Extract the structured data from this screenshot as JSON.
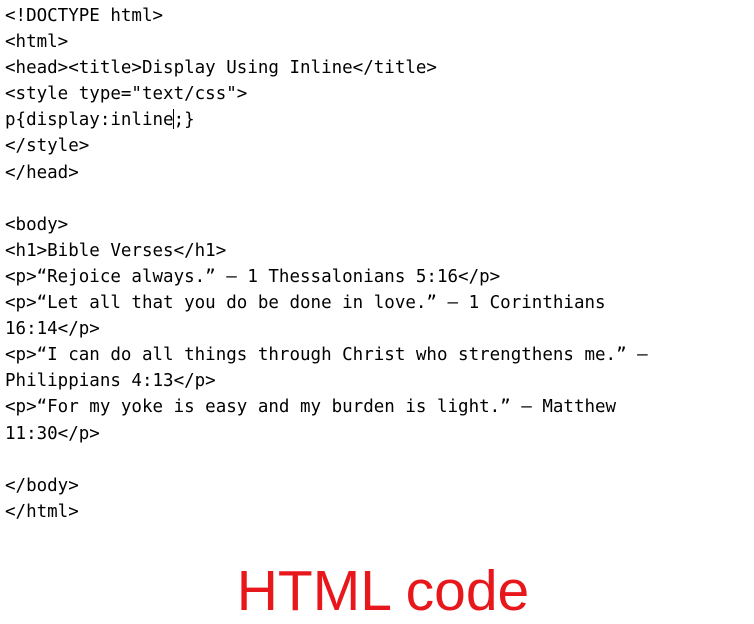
{
  "code": {
    "lines": [
      "<!DOCTYPE html>",
      "<html>",
      "<head><title>Display Using Inline</title>",
      "<style type=\"text/css\">",
      "p{display:inline;}",
      "</style>",
      "</head>",
      "",
      "<body>",
      "<h1>Bible Verses</h1>",
      "<p>“Rejoice always.” — 1 Thessalonians 5:16</p>",
      "<p>“Let all that you do be done in love.” — 1 Corinthians",
      "16:14</p>",
      "<p>“I can do all things through Christ who strengthens me.” —",
      "Philippians 4:13</p>",
      "<p>“For my yoke is easy and my burden is light.” — Matthew",
      "11:30</p>",
      "",
      "</body>",
      "</html>"
    ],
    "cursor_line_before": "p{display:inline",
    "cursor_line_after": ";}"
  },
  "caption": "HTML code",
  "colors": {
    "caption": "#e8171b",
    "code": "#000000",
    "background": "#ffffff"
  }
}
